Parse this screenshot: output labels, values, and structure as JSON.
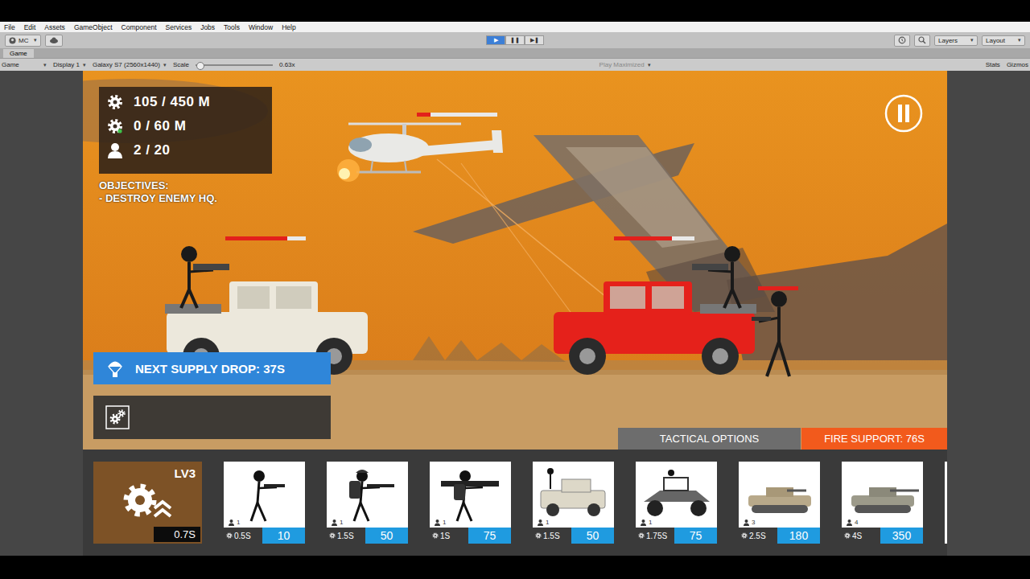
{
  "editor": {
    "menu": [
      "File",
      "Edit",
      "Assets",
      "GameObject",
      "Component",
      "Services",
      "Jobs",
      "Tools",
      "Window",
      "Help"
    ],
    "account": "MC",
    "play_controls": [
      {
        "icon": "▶",
        "selected": true
      },
      {
        "icon": "❚❚",
        "selected": false
      },
      {
        "icon": "▶❚",
        "selected": false
      }
    ],
    "layers": "Layers",
    "layout": "Layout",
    "tab": "Game",
    "game_toolbar": {
      "view": "Game",
      "display": "Display 1",
      "resolution": "Galaxy S7 (2560x1440)",
      "scale_label": "Scale",
      "scale_level": 0.03,
      "scale_value": "0.63x",
      "play_maximized": "Play Maximized",
      "play_maximized_enabled": false,
      "stats": "Stats",
      "gizmos": "Gizmos"
    }
  },
  "hud": {
    "stats": [
      {
        "kind": "gear",
        "value": "105 / 450 M"
      },
      {
        "kind": "gear-e",
        "value": "0 / 60 M"
      },
      {
        "kind": "person",
        "value": "2 / 20"
      }
    ],
    "objectives_title": "OBJECTIVES:",
    "objectives": [
      "- DESTROY ENEMY HQ."
    ],
    "supply_drop": "NEXT SUPPLY DROP: 37S",
    "tactical_options": "TACTICAL OPTIONS",
    "fire_support": "FIRE SUPPORT: 76S"
  },
  "battlefield": [
    {
      "kind": "helicopter",
      "level": 0.17,
      "color": "#e9e9e6",
      "facing": "left"
    },
    {
      "kind": "jeep",
      "level": 0.77,
      "color": "#ece8dc",
      "facing": "right"
    },
    {
      "kind": "jeep",
      "level": 0.72,
      "color": "#e5211b",
      "facing": "left"
    },
    {
      "kind": "soldier",
      "level": 1,
      "color": "#1a1a1a",
      "facing": "left"
    }
  ],
  "upgrade": {
    "level": "LV3",
    "time": "0.7S"
  },
  "units": [
    {
      "kind": "rifleman",
      "pop": "1",
      "time": "0.5S",
      "cost": "10"
    },
    {
      "kind": "heavy",
      "pop": "1",
      "time": "1.5S",
      "cost": "50"
    },
    {
      "kind": "rocket",
      "pop": "1",
      "time": "1S",
      "cost": "75"
    },
    {
      "kind": "jeep",
      "pop": "1",
      "time": "1.5S",
      "cost": "50"
    },
    {
      "kind": "buggy",
      "pop": "1",
      "time": "1.75S",
      "cost": "75"
    },
    {
      "kind": "ifv",
      "pop": "3",
      "time": "2.5S",
      "cost": "180"
    },
    {
      "kind": "tank",
      "pop": "4",
      "time": "4S",
      "cost": "350"
    }
  ]
}
